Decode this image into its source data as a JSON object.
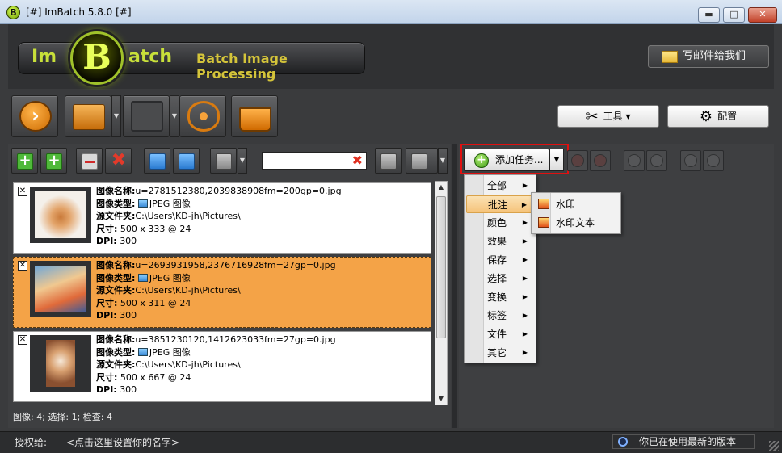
{
  "window": {
    "title": "[#] ImBatch 5.8.0 [#]",
    "icon_letter": "B",
    "controls": {
      "minimize": "▬",
      "maximize": "□",
      "close": "✕"
    }
  },
  "banner": {
    "logo_im": "Im",
    "logo_b": "B",
    "logo_atch": "atch",
    "tagline": "Batch Image Processing",
    "mail_button": "写邮件给我们"
  },
  "toolbar": {
    "tools_label": "工具",
    "config_label": "配置"
  },
  "left": {
    "search": {
      "value": "",
      "placeholder": ""
    },
    "images": [
      {
        "name_label": "图像名称:",
        "name": "u=2781512380,2039838908fm=200gp=0.jpg",
        "type_label": "图像类型:",
        "type": "JPEG 图像",
        "folder_label": "源文件夹:",
        "folder": "C:\\Users\\KD-jh\\Pictures\\",
        "size_label": "尺寸:",
        "size": "500 x 333 @ 24",
        "dpi_label": "DPI:",
        "dpi": "300",
        "checked": "✕",
        "selected": false
      },
      {
        "name_label": "图像名称:",
        "name": "u=2693931958,2376716928fm=27gp=0.jpg",
        "type_label": "图像类型:",
        "type": "JPEG 图像",
        "folder_label": "源文件夹:",
        "folder": "C:\\Users\\KD-jh\\Pictures\\",
        "size_label": "尺寸:",
        "size": "500 x 311 @ 24",
        "dpi_label": "DPI:",
        "dpi": "300",
        "checked": "✕",
        "selected": true
      },
      {
        "name_label": "图像名称:",
        "name": "u=3851230120,1412623033fm=27gp=0.jpg",
        "type_label": "图像类型:",
        "type": "JPEG 图像",
        "folder_label": "源文件夹:",
        "folder": "C:\\Users\\KD-jh\\Pictures\\",
        "size_label": "尺寸:",
        "size": "500 x 667 @ 24",
        "dpi_label": "DPI:",
        "dpi": "300",
        "checked": "✕",
        "selected": false
      }
    ],
    "status": "图像: 4; 选择: 1; 检查: 4"
  },
  "right": {
    "add_task": "添加任务...",
    "menu": [
      {
        "label": "全部"
      },
      {
        "label": "批注"
      },
      {
        "label": "颜色"
      },
      {
        "label": "效果"
      },
      {
        "label": "保存"
      },
      {
        "label": "选择"
      },
      {
        "label": "变换"
      },
      {
        "label": "标签"
      },
      {
        "label": "文件"
      },
      {
        "label": "其它"
      }
    ],
    "active_menu": "批注",
    "submenu": [
      {
        "label": "水印"
      },
      {
        "label": "水印文本"
      }
    ]
  },
  "statusbar": {
    "license_label": "授权给:",
    "license_name": "<点击这里设置你的名字>",
    "version_status": "你已在使用最新的版本"
  },
  "colors": {
    "selection": "#f4a347",
    "accent_red": "#e01010",
    "logo_green": "#c8e03a"
  }
}
